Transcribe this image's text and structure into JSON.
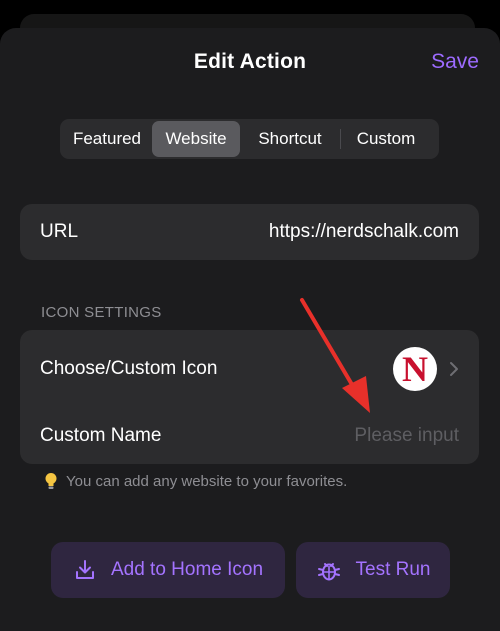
{
  "header": {
    "title": "Edit Action",
    "save_label": "Save"
  },
  "tabs": [
    {
      "label": "Featured",
      "active": false
    },
    {
      "label": "Website",
      "active": true
    },
    {
      "label": "Shortcut",
      "active": false
    },
    {
      "label": "Custom",
      "active": false
    }
  ],
  "url_row": {
    "label": "URL",
    "value": "https://nerdschalk.com"
  },
  "icon_settings": {
    "section_label": "ICON SETTINGS",
    "choose_label": "Choose/Custom Icon",
    "icon_letter": "N",
    "name_label": "Custom Name",
    "name_placeholder": "Please input"
  },
  "hint": "You can add any website to your favorites.",
  "buttons": {
    "add_home": "Add to Home Icon",
    "test_run": "Test Run"
  },
  "colors": {
    "accent": "#9d6bff",
    "annotation_arrow": "#e8302a"
  }
}
